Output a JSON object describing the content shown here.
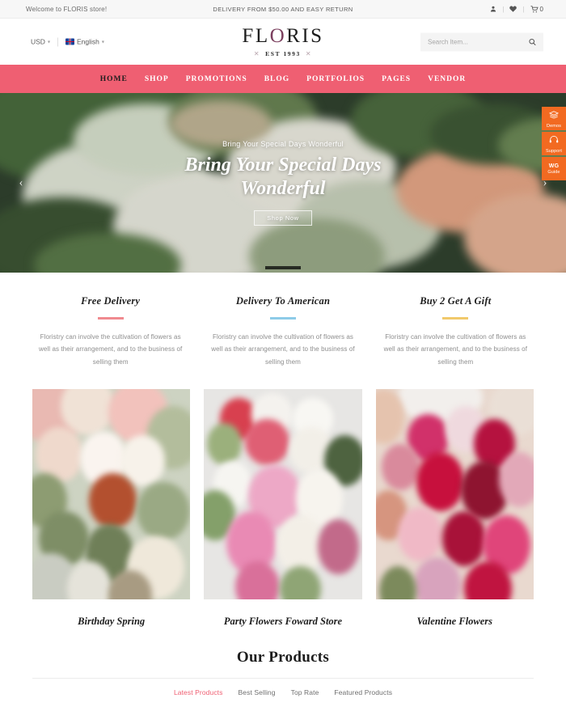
{
  "topbar": {
    "welcome": "Welcome to FLORIS store!",
    "delivery": "DELIVERY FROM $50.00 AND EASY RETURN",
    "separator": "|",
    "cart_count": "0",
    "account_icon": "user-icon",
    "wishlist_icon": "heart-icon",
    "cart_icon": "cart-icon"
  },
  "header": {
    "currency": "USD",
    "language": "English",
    "logo_pre": "FL",
    "logo_o": "O",
    "logo_post": "RIS",
    "logo_full": "FLORIS",
    "logo_tagline": "EST 1993",
    "tagline_ornament": "✕",
    "search_placeholder": "Search Item...",
    "search_value": "",
    "search_icon": "search-icon",
    "caret_icon": "chevron-down-icon",
    "flag_icon": "uk-flag-icon"
  },
  "nav": {
    "items": [
      {
        "label": "HOME",
        "active": true
      },
      {
        "label": "SHOP",
        "active": false
      },
      {
        "label": "PROMOTIONS",
        "active": false
      },
      {
        "label": "BLOG",
        "active": false
      },
      {
        "label": "PORTFOLIOS",
        "active": false
      },
      {
        "label": "PAGES",
        "active": false
      },
      {
        "label": "VENDOR",
        "active": false
      }
    ],
    "background_color": "#ef5f72"
  },
  "hero": {
    "kicker": "Bring Your Special Days Wonderful",
    "title": "Bring Your Special Days Wonderful",
    "cta_label": "Shop Now",
    "prev_icon": "chevron-left-icon",
    "next_icon": "chevron-right-icon",
    "prev_glyph": "‹",
    "next_glyph": "›"
  },
  "side_buttons": [
    {
      "label": "Demos",
      "icon": "layers-icon"
    },
    {
      "label": "Support",
      "icon": "headset-icon"
    },
    {
      "label": "Guide",
      "icon": "wg-logo-icon",
      "badge": "WG"
    }
  ],
  "features": [
    {
      "title": "Free Delivery",
      "rule_color": "#f08a8f",
      "text": "Floristry can involve the cultivation of flowers as well as their arrangement, and to the business of selling them"
    },
    {
      "title": "Delivery To American",
      "rule_color": "#8ecbe8",
      "text": "Floristry can involve the cultivation of flowers as well as their arrangement, and to the business of selling them"
    },
    {
      "title": "Buy 2 Get A Gift",
      "rule_color": "#f1c96b",
      "text": "Floristry can involve the cultivation of flowers as well as their arrangement, and to the business of selling them"
    }
  ],
  "categories": [
    {
      "caption": "Birthday Spring",
      "image": "pink-white-bouquet-in-jars"
    },
    {
      "caption": "Party Flowers Foward Store",
      "image": "pink-peony-bouquet"
    },
    {
      "caption": "Valentine Flowers",
      "image": "red-crimson-bridal-bouquet"
    }
  ],
  "products": {
    "title": "Our Products",
    "tabs": [
      {
        "label": "Latest Products",
        "active": true
      },
      {
        "label": "Best Selling",
        "active": false
      },
      {
        "label": "Top Rate",
        "active": false
      },
      {
        "label": "Featured Products",
        "active": false
      }
    ],
    "accent_color": "#ef5f72"
  }
}
